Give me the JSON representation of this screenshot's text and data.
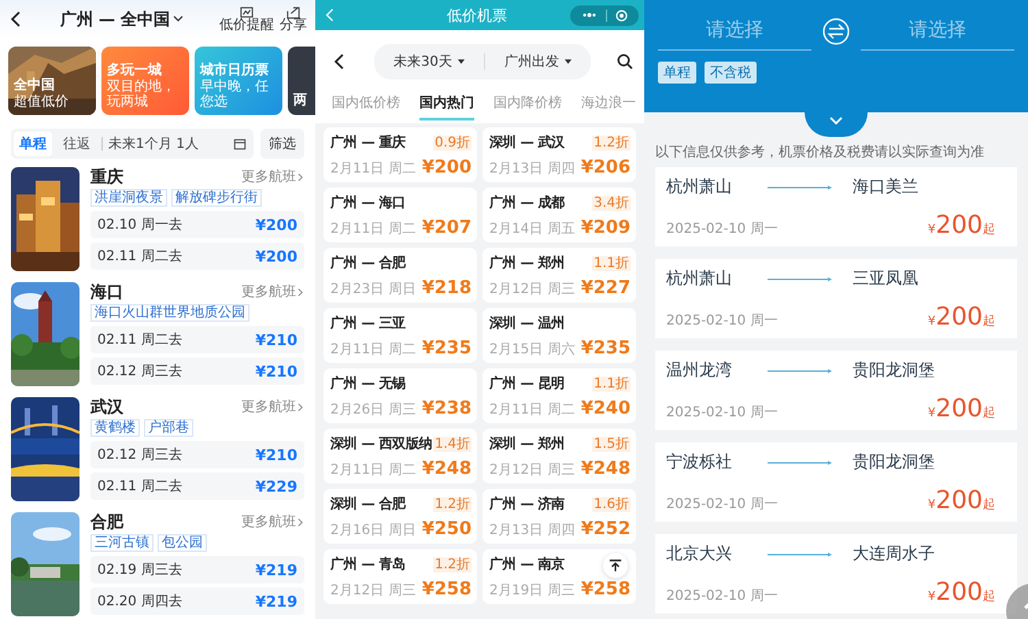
{
  "left": {
    "header": {
      "title": "广州 — 全中国",
      "actions": [
        "低价提醒",
        "分享"
      ]
    },
    "banners": [
      {
        "title": "全中国",
        "subtitle": "超值低价"
      },
      {
        "title": "多玩一城",
        "subtitle": "双目的地，玩两城"
      },
      {
        "title": "城市日历票",
        "subtitle": "早中晚，任您选"
      },
      {
        "title": "两"
      }
    ],
    "trip_types": [
      {
        "label": "单程",
        "selected": true
      },
      {
        "label": "往返",
        "selected": false
      }
    ],
    "date_field": {
      "value": "未来1个月 1人"
    },
    "filter_button": "筛选",
    "destinations": [
      {
        "kind": "picture",
        "name": "重庆",
        "more": "更多航班",
        "tags": [
          "洪崖洞夜景",
          "解放碑步行街"
        ],
        "dates": [
          {
            "date": "02.10 周一去",
            "price": "¥200"
          },
          {
            "date": "02.11 周二去",
            "price": "¥200"
          }
        ]
      },
      {
        "kind": "picture",
        "name": "海口",
        "more": "更多航班",
        "tags": [
          "海口火山群世界地质公园"
        ],
        "dates": [
          {
            "date": "02.11 周二去",
            "price": "¥210"
          },
          {
            "date": "02.12 周三去",
            "price": "¥210"
          }
        ]
      },
      {
        "kind": "picture",
        "name": "武汉",
        "more": "更多航班",
        "tags": [
          "黄鹤楼",
          "户部巷"
        ],
        "dates": [
          {
            "date": "02.12 周三去",
            "price": "¥210"
          },
          {
            "date": "02.11 周二去",
            "price": "¥229"
          }
        ]
      },
      {
        "kind": "picture",
        "name": "合肥",
        "more": "更多航班",
        "tags": [
          "三河古镇",
          "包公园"
        ],
        "dates": [
          {
            "date": "02.19 周三去",
            "price": "¥219"
          },
          {
            "date": "02.20 周四去",
            "price": "¥219"
          }
        ]
      }
    ]
  },
  "middle": {
    "title": "低价机票",
    "date_filter": "未来30天",
    "origin_filter": "广州出发",
    "tabs": [
      {
        "label": "国内低价榜",
        "selected": false
      },
      {
        "label": "国内热门",
        "selected": true
      },
      {
        "label": "国内降价榜",
        "selected": false
      },
      {
        "label": "海边浪一",
        "selected": false
      }
    ],
    "deals": [
      {
        "route": "广州 — 重庆",
        "date": "2月11日 周二",
        "discount": "0.9折",
        "price": "¥200"
      },
      {
        "route": "深圳 — 武汉",
        "date": "2月13日 周四",
        "discount": "1.2折",
        "price": "¥206"
      },
      {
        "route": "广州 — 海口",
        "date": "2月11日 周二",
        "price": "¥207"
      },
      {
        "route": "广州 — 成都",
        "date": "2月14日 周五",
        "discount": "3.4折",
        "price": "¥209"
      },
      {
        "route": "广州 — 合肥",
        "date": "2月23日 周日",
        "price": "¥218"
      },
      {
        "route": "广州 — 郑州",
        "date": "2月12日 周三",
        "discount": "1.1折",
        "price": "¥227"
      },
      {
        "route": "广州 — 三亚",
        "date": "2月11日 周二",
        "price": "¥235"
      },
      {
        "route": "深圳 — 温州",
        "date": "2月15日 周六",
        "price": "¥235"
      },
      {
        "route": "广州 — 无锡",
        "date": "2月26日 周三",
        "price": "¥238"
      },
      {
        "route": "广州 — 昆明",
        "date": "2月11日 周二",
        "discount": "1.1折",
        "price": "¥240"
      },
      {
        "route": "深圳 — 西双版纳",
        "date": "2月11日 周二",
        "discount": "1.4折",
        "price": "¥248"
      },
      {
        "route": "深圳 — 郑州",
        "date": "2月12日 周三",
        "discount": "1.5折",
        "price": "¥248"
      },
      {
        "route": "深圳 — 合肥",
        "date": "2月16日 周日",
        "discount": "1.2折",
        "price": "¥250"
      },
      {
        "route": "广州 — 济南",
        "date": "2月13日 周四",
        "discount": "1.6折",
        "price": "¥252"
      },
      {
        "route": "广州 — 青岛",
        "date": "2月12日 周三",
        "discount": "1.2折",
        "price": "¥258"
      },
      {
        "route": "广州 — 南京",
        "date": "2月19日 周三",
        "price": "¥258"
      }
    ]
  },
  "right": {
    "from_placeholder": "请选择",
    "to_placeholder": "请选择",
    "tags": [
      "单程",
      "不含税"
    ],
    "notice": "以下信息仅供参考，机票价格及税费请以实际查询为准",
    "routes": [
      {
        "from": "杭州萧山",
        "to": "海口美兰",
        "date": "2025-02-10 周一",
        "currency": "¥",
        "amount": "200",
        "suffix": "起"
      },
      {
        "from": "杭州萧山",
        "to": "三亚凤凰",
        "date": "2025-02-10 周一",
        "currency": "¥",
        "amount": "200",
        "suffix": "起"
      },
      {
        "from": "温州龙湾",
        "to": "贵阳龙洞堡",
        "date": "2025-02-10 周一",
        "currency": "¥",
        "amount": "200",
        "suffix": "起"
      },
      {
        "from": "宁波栎社",
        "to": "贵阳龙洞堡",
        "date": "2025-02-10 周一",
        "currency": "¥",
        "amount": "200",
        "suffix": "起"
      },
      {
        "from": "北京大兴",
        "to": "大连周水子",
        "date": "2025-02-10 周一",
        "currency": "¥",
        "amount": "200",
        "suffix": "起"
      }
    ]
  }
}
